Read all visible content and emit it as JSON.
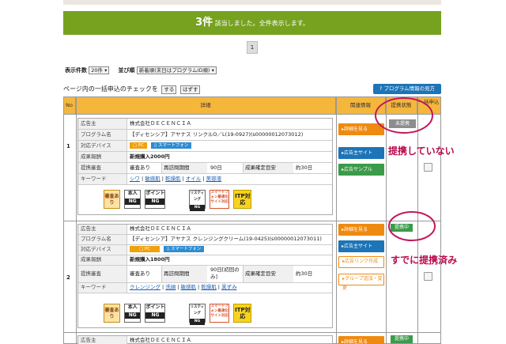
{
  "banner": {
    "count": "3件",
    "text": "該当しました。全件表示します。"
  },
  "pager": {
    "page": "1"
  },
  "controls": {
    "display_label": "表示件数",
    "display_value": "20件 ▾",
    "sort_label": "並び順",
    "sort_value": "新着順(末日はプログラムID順) ▾",
    "check_label": "ページ内の一括申込のチェックを",
    "check_on": "する",
    "check_off": "はずす",
    "guide": "? プログラム情報の見方"
  },
  "table_headers": {
    "no": "No",
    "detail": "詳細",
    "related": "関連情報",
    "status": "提携状態",
    "bulk": "一括申込"
  },
  "row_keys": {
    "advertiser": "広告主",
    "program": "プログラム名",
    "device": "対応デバイス",
    "reward": "成果報酬",
    "review": "提携審査",
    "keyword": "キーワード",
    "cycle": "再訪問期間",
    "confirm": "成果確定目安"
  },
  "devices": {
    "pc": "PC",
    "sp": "スマートフォン"
  },
  "rows": [
    {
      "no": "1",
      "advertiser": "株式会社ＤＥＣＥＮＣＩＡ",
      "program": "【ディセンシア】アヤナス リンクルO／L(19-0927)(s00000012073012)",
      "reward": "新規購入2000円",
      "review": "審査あり",
      "cycle": "90日",
      "confirm": "約30日",
      "keywords": [
        "シワ",
        "敏感肌",
        "乾燥肌",
        "オイル",
        "美容液"
      ],
      "status": "未提携"
    },
    {
      "no": "2",
      "advertiser": "株式会社ＤＥＣＥＮＣＩＡ",
      "program": "【ディセンシア】アヤナス クレンジングクリーム(19-0425)(s00000012073011)",
      "reward": "新規購入1800円",
      "review": "審査あり",
      "cycle": "90日[初回のみ]",
      "confirm": "約30日",
      "keywords": [
        "クレンジング",
        "洗顔",
        "敏感肌",
        "乾燥肌",
        "黒ずみ"
      ],
      "status": "提携中"
    },
    {
      "no": "3",
      "advertiser": "株式会社ＤＥＣＥＮＣＩＡ",
      "status": "提携中"
    }
  ],
  "badges": {
    "review": "審査あり",
    "personal": [
      "本人",
      "NG"
    ],
    "point": [
      "ポイント",
      "NG"
    ],
    "listing": [
      "リスティング",
      "NG"
    ],
    "smartphone": "スマートフォン最適化サイト対応",
    "itp": "ITP対応"
  },
  "actions": {
    "detail": "▸詳細を見る",
    "advertiser_site": "▸広告主サイト",
    "sample": "▸広告サンプル",
    "link": "▸広告リンク作成",
    "group": "▸グループ追加・変更"
  },
  "annotations": {
    "not_partnered": "提携していない",
    "already_partnered": "すでに提携済み",
    "color": "#c2185b"
  }
}
